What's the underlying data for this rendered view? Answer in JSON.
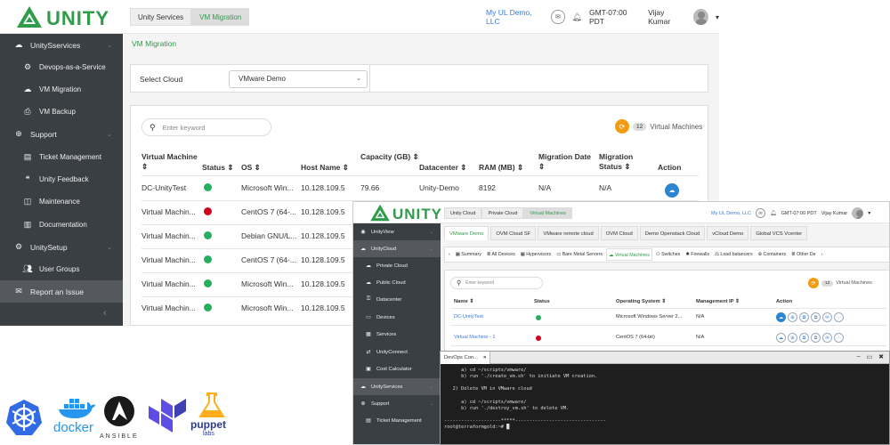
{
  "brand": {
    "name": "UNITY",
    "color": "#2e9c49"
  },
  "win1": {
    "breadcrumb": [
      "Unity Services",
      "VM Migration"
    ],
    "org": "My UL Demo, LLC",
    "timezone": "GMT-07:00 PDT",
    "user": "Vijay Kumar",
    "page_title": "VM Migration",
    "select_cloud_label": "Select Cloud",
    "select_cloud_value": "VMware Demo",
    "search_placeholder": "Enter keyword",
    "vm_count": "12",
    "vm_count_label": "Virtual Machines",
    "sidebar": [
      {
        "label": "UnitySservices",
        "icon": "cloud-share-icon",
        "type": "main",
        "chevron": true
      },
      {
        "label": "Devops-as-a-Service",
        "icon": "devops-icon",
        "type": "sub"
      },
      {
        "label": "VM Migration",
        "icon": "cloud-upload-icon",
        "type": "sub"
      },
      {
        "label": "VM Backup",
        "icon": "backup-icon",
        "type": "sub"
      },
      {
        "label": "Support",
        "icon": "support-icon",
        "type": "main",
        "chevron": true
      },
      {
        "label": "Ticket Management",
        "icon": "ticket-icon",
        "type": "sub"
      },
      {
        "label": "Unity Feedback",
        "icon": "feedback-icon",
        "type": "sub"
      },
      {
        "label": "Maintenance",
        "icon": "maintenance-icon",
        "type": "sub"
      },
      {
        "label": "Documentation",
        "icon": "document-icon",
        "type": "sub"
      },
      {
        "label": "UnitySetup",
        "icon": "cogs-icon",
        "type": "main",
        "chevron": true
      },
      {
        "label": "User Groups",
        "icon": "users-icon",
        "type": "sub"
      },
      {
        "label": "Report an Issue",
        "icon": "envelope-icon",
        "type": "main",
        "active": true
      }
    ],
    "columns": [
      "Virtual Machine ⇕",
      "Status ⇕",
      "OS ⇕",
      "Host Name ⇕",
      "Capacity (GB) ⇕",
      "Datacenter ⇕",
      "RAM (MB) ⇕",
      "Migration Date ⇕",
      "Migration Status ⇕",
      "Action"
    ],
    "rows": [
      {
        "vm": "DC-UnityTest",
        "status": "green",
        "os": "Microsoft Win...",
        "host": "10.128.109.5",
        "capacity": "79.66",
        "datacenter": "Unity-Demo",
        "ram": "8192",
        "mdate": "N/A",
        "mstatus": "N/A",
        "action": true
      },
      {
        "vm": "Virtual Machin...",
        "status": "red",
        "os": "CentOS 7 (64-...",
        "host": "10.128.109.5"
      },
      {
        "vm": "Virtual Machin...",
        "status": "green",
        "os": "Debian GNU/L...",
        "host": "10.128.109.5"
      },
      {
        "vm": "Virtual Machin...",
        "status": "green",
        "os": "CentOS 7 (64-...",
        "host": "10.128.109.5"
      },
      {
        "vm": "Virtual Machin...",
        "status": "green",
        "os": "Microsoft Win...",
        "host": "10.128.109.5"
      },
      {
        "vm": "Virtual Machin...",
        "status": "green",
        "os": "Microsoft Win...",
        "host": "10.128.109.5"
      }
    ]
  },
  "win2": {
    "breadcrumb": [
      "Unity Cloud",
      "Private Cloud",
      "Virtual Machines"
    ],
    "org": "My UL Demo, LLC",
    "timezone": "GMT-07:00 PDT",
    "user": "Vijay Kumar",
    "sidebar": [
      {
        "label": "UnityView",
        "icon": "view-icon",
        "type": "main",
        "chevron": true
      },
      {
        "label": "UnityCloud",
        "icon": "cloud-icon",
        "type": "main",
        "chevron": true,
        "active": true
      },
      {
        "label": "Private Cloud",
        "icon": "cloud-icon",
        "type": "sub"
      },
      {
        "label": "Public Cloud",
        "icon": "cloud-icon",
        "type": "sub"
      },
      {
        "label": "Datacenter",
        "icon": "datacenter-icon",
        "type": "sub"
      },
      {
        "label": "Devices",
        "icon": "devices-icon",
        "type": "sub"
      },
      {
        "label": "Services",
        "icon": "services-icon",
        "type": "sub"
      },
      {
        "label": "UnityConnect",
        "icon": "connect-icon",
        "type": "sub"
      },
      {
        "label": "Cost Calculator",
        "icon": "calculator-icon",
        "type": "sub"
      },
      {
        "label": "UnityServices",
        "icon": "cloud-share-icon",
        "type": "main",
        "chevron": true,
        "active": true
      },
      {
        "label": "Support",
        "icon": "support-icon",
        "type": "main",
        "chevron": true
      },
      {
        "label": "Ticket Management",
        "icon": "ticket-icon",
        "type": "sub"
      }
    ],
    "cloud_tabs": [
      "VMware Demo",
      "OVM Cloud SF",
      "VMware remote cloud",
      "OVM Cloud",
      "Demo Openstack Cloud",
      "vCloud Demo",
      "Global VCS Vcenter"
    ],
    "sub_tabs": [
      "‹",
      "Summary",
      "All Devices",
      "Hypervisors",
      "Bare Metal Servers",
      "Virtual Machines",
      "Switches",
      "Firewalls",
      "Load balancers",
      "Containers",
      "Other De",
      "›"
    ],
    "search_placeholder": "Enter keyword",
    "vm_count": "12",
    "vm_count_label": "Virtual Machines",
    "columns": [
      "Name ⇕",
      "Status",
      "Operating System ⇕",
      "Management IP ⇕",
      "Action"
    ],
    "rows": [
      {
        "name": "DC-UnityTest",
        "status": "green",
        "os": "Microsoft Windows Server 2...",
        "ip": "N/A"
      },
      {
        "name": "Virtual Machine - 1",
        "status": "red",
        "os": "CentOS 7 (64-bit)",
        "ip": "N/A"
      }
    ]
  },
  "terminal": {
    "tab_title": "DevOps Con...",
    "tab_close": "×",
    "controls": [
      "–",
      "▭",
      "✖"
    ],
    "lines": [
      "      a) cd ~/scripts/vmware/",
      "      b) run './create_vm.sh' to initiate VM creation.",
      "",
      "   2) Delete VM in VMware cloud",
      "",
      "      a) cd ~/scripts/vmware/",
      "      b) run './destroy_vm.sh' to delete VM.",
      "",
      "--------------------*****--------------------------------",
      "root@terraformgold:~# █"
    ]
  },
  "logos": {
    "docker": "docker",
    "ansible": "ANSIBLE",
    "puppet": "puppet",
    "puppet_sub": "labs"
  },
  "colors": {
    "green": "#27ae60",
    "red": "#d0021b",
    "sidebar": "#3a3f44",
    "link": "#3a7bd5",
    "orange": "#f39c12"
  }
}
